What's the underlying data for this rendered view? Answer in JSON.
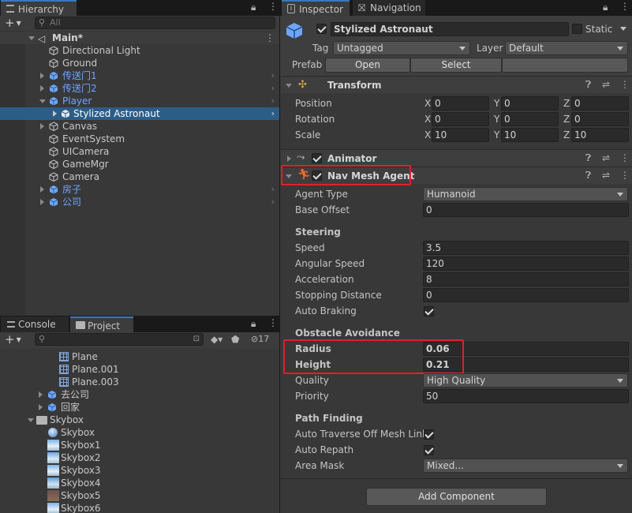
{
  "hierarchy": {
    "tab_label": "Hierarchy",
    "add_label": "+",
    "search_placeholder": "All",
    "scene_name": "Main*",
    "items": [
      {
        "label": "Directional Light"
      },
      {
        "label": "Ground"
      },
      {
        "label": "传送门1"
      },
      {
        "label": "传送门2"
      },
      {
        "label": "Player"
      },
      {
        "label": "Stylized Astronaut"
      },
      {
        "label": "Canvas"
      },
      {
        "label": "EventSystem"
      },
      {
        "label": "UICamera"
      },
      {
        "label": "GameMgr"
      },
      {
        "label": "Camera"
      },
      {
        "label": "房子"
      },
      {
        "label": "公司"
      }
    ]
  },
  "project": {
    "tab_console": "Console",
    "tab_project": "Project",
    "add_label": "+",
    "hidden_count": "17",
    "items": [
      {
        "label": "Plane"
      },
      {
        "label": "Plane.001"
      },
      {
        "label": "Plane.003"
      },
      {
        "label": "去公司"
      },
      {
        "label": "回家"
      },
      {
        "label": "Skybox"
      },
      {
        "label": "Skybox"
      },
      {
        "label": "Skybox1"
      },
      {
        "label": "Skybox2"
      },
      {
        "label": "Skybox3"
      },
      {
        "label": "Skybox4"
      },
      {
        "label": "Skybox5"
      },
      {
        "label": "Skybox6"
      }
    ]
  },
  "inspector": {
    "tab_inspector": "Inspector",
    "tab_navigation": "Navigation",
    "object_name": "Stylized Astronaut",
    "static_label": "Static",
    "tag_label": "Tag",
    "tag_value": "Untagged",
    "layer_label": "Layer",
    "layer_value": "Default",
    "prefab_label": "Prefab",
    "open_label": "Open",
    "select_label": "Select",
    "transform": {
      "title": "Transform",
      "position_label": "Position",
      "rotation_label": "Rotation",
      "scale_label": "Scale",
      "x": "X",
      "y": "Y",
      "z": "Z",
      "position": [
        "0",
        "0",
        "0"
      ],
      "rotation": [
        "0",
        "0",
        "0"
      ],
      "scale": [
        "10",
        "10",
        "10"
      ]
    },
    "animator": {
      "title": "Animator"
    },
    "navmesh": {
      "title": "Nav Mesh Agent",
      "agent_type_label": "Agent Type",
      "agent_type_value": "Humanoid",
      "base_offset_label": "Base Offset",
      "base_offset_value": "0",
      "steering_label": "Steering",
      "speed_label": "Speed",
      "speed_value": "3.5",
      "angular_speed_label": "Angular Speed",
      "angular_speed_value": "120",
      "acceleration_label": "Acceleration",
      "acceleration_value": "8",
      "stopping_distance_label": "Stopping Distance",
      "stopping_distance_value": "0",
      "auto_braking_label": "Auto Braking",
      "obstacle_label": "Obstacle Avoidance",
      "radius_label": "Radius",
      "radius_value": "0.06",
      "height_label": "Height",
      "height_value": "0.21",
      "quality_label": "Quality",
      "quality_value": "High Quality",
      "priority_label": "Priority",
      "priority_value": "50",
      "pathfinding_label": "Path Finding",
      "auto_traverse_label": "Auto Traverse Off Mesh Link",
      "auto_repath_label": "Auto Repath",
      "area_mask_label": "Area Mask",
      "area_mask_value": "Mixed..."
    },
    "add_component_label": "Add Component"
  },
  "colors": {
    "selection": "#2c5d87",
    "highlight_box": "#e0202a",
    "prefab_blue": "#6ea6ff"
  }
}
